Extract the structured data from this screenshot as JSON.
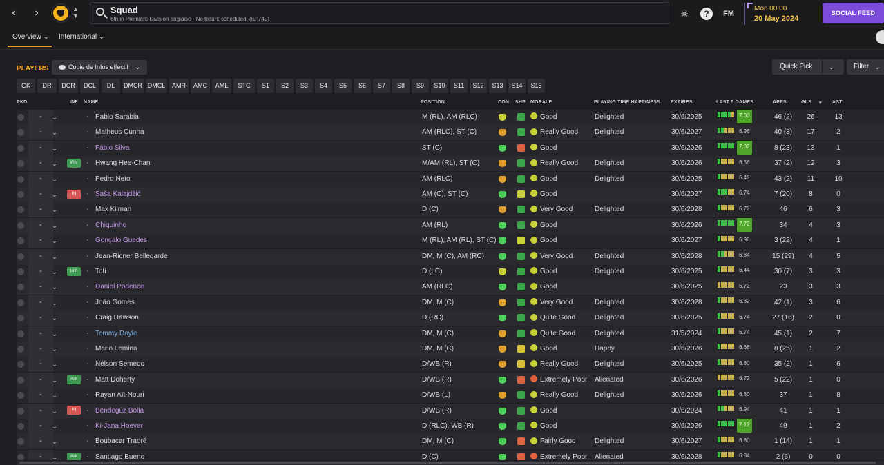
{
  "header": {
    "title": "Squad",
    "subtitle": "6th in Première Division anglaise - No fixture scheduled. (ID:740)",
    "date_line1": "Mon 00:00",
    "date_line2": "20 May 2024",
    "social_feed": "SOCIAL FEED",
    "fm_label": "FM",
    "help_label": "?"
  },
  "tabs": [
    {
      "label": "Overview ⌄"
    },
    {
      "label": "International ⌄"
    }
  ],
  "toolbar": {
    "players_label": "PLAYERS",
    "view_selector": "Copie de Infos effectif",
    "quick_pick": "Quick Pick",
    "filter": "Filter"
  },
  "position_filters": [
    "GK",
    "DR",
    "DCR",
    "DCL",
    "DL",
    "DMCR",
    "DMCL",
    "AMR",
    "AMC",
    "AML",
    "STC",
    "S1",
    "S2",
    "S3",
    "S4",
    "S5",
    "S6",
    "S7",
    "S8",
    "S9",
    "S10",
    "S11",
    "S12",
    "S13",
    "S14",
    "S15"
  ],
  "columns": {
    "pkd": "PKD",
    "inf": "INF",
    "name": "NAME",
    "position": "POSITION",
    "con": "CON",
    "shp": "SHP",
    "morale": "MORALE",
    "pth": "PLAYING TIME HAPPINESS",
    "expires": "EXPIRES",
    "last5": "LAST 5 GAMES",
    "apps": "APPS",
    "gls": "GLS",
    "ast": "AST"
  },
  "colors": {
    "accent_orange": "#f0a12c",
    "social_purple": "#7a4cd8",
    "loan_name": "#c497ea",
    "future_name": "#7fb2e6",
    "rating_high": "#4fa52a"
  },
  "players": [
    {
      "dash": "-",
      "inf": "",
      "name": "Pablo Sarabia",
      "style": "",
      "position": "M (RL), AM (RLC)",
      "con": "#c9d13a",
      "shp": "#3aa84a",
      "morale": "Good",
      "mcol": "#c9d13a",
      "pth": "Delighted",
      "expires": "30/6/2025",
      "bars": [
        "#3fbf4a",
        "#3fbf4a",
        "#3fbf4a",
        "#3fbf4a",
        "#c8b050"
      ],
      "rating": "7.00",
      "hi": true,
      "apps": "46 (2)",
      "gls": "26",
      "ast": "13"
    },
    {
      "dash": "-",
      "inf": "",
      "name": "Matheus Cunha",
      "style": "",
      "position": "AM (RLC), ST (C)",
      "con": "#e0a030",
      "shp": "#3aa84a",
      "morale": "Really Good",
      "mcol": "#c9d13a",
      "pth": "Delighted",
      "expires": "30/6/2027",
      "bars": [
        "#3fbf4a",
        "#3fbf4a",
        "#c8b050",
        "#c8b050",
        "#c8b050"
      ],
      "rating": "6.96",
      "hi": false,
      "apps": "40 (3)",
      "gls": "17",
      "ast": "2"
    },
    {
      "dash": "-",
      "inf": "",
      "name": "Fábio Silva",
      "style": "loan",
      "position": "ST (C)",
      "con": "#4fd05a",
      "shp": "#e06040",
      "morale": "Good",
      "mcol": "#c9d13a",
      "pth": "",
      "expires": "30/6/2026",
      "bars": [
        "#3fbf4a",
        "#3fbf4a",
        "#3fbf4a",
        "#3fbf4a",
        "#3fbf4a"
      ],
      "rating": "7.02",
      "hi": true,
      "apps": "8 (23)",
      "gls": "13",
      "ast": "1"
    },
    {
      "dash": "-",
      "inf": "Wnt",
      "infc": "green",
      "name": "Hwang Hee-Chan",
      "style": "",
      "position": "M/AM (RL), ST (C)",
      "con": "#e0a030",
      "shp": "#3aa84a",
      "morale": "Really Good",
      "mcol": "#c9d13a",
      "pth": "Delighted",
      "expires": "30/6/2026",
      "bars": [
        "#3fbf4a",
        "#c8b050",
        "#c8b050",
        "#c8b050",
        "#c8b050"
      ],
      "rating": "6.56",
      "hi": false,
      "apps": "37 (2)",
      "gls": "12",
      "ast": "3"
    },
    {
      "dash": "-",
      "inf": "",
      "name": "Pedro Neto",
      "style": "",
      "position": "AM (RLC)",
      "con": "#e0a030",
      "shp": "#3aa84a",
      "morale": "Good",
      "mcol": "#c9d13a",
      "pth": "Delighted",
      "expires": "30/6/2025",
      "bars": [
        "#3fbf4a",
        "#c8b050",
        "#c8b050",
        "#c8b050",
        "#c8b050"
      ],
      "rating": "6.42",
      "hi": false,
      "apps": "43 (2)",
      "gls": "11",
      "ast": "10"
    },
    {
      "dash": "-",
      "inf": "Inj",
      "infc": "red",
      "name": "Saša Kalajdžić",
      "style": "loan",
      "position": "AM (C), ST (C)",
      "con": "#4fd05a",
      "shp": "#c9d13a",
      "morale": "Good",
      "mcol": "#c9d13a",
      "pth": "",
      "expires": "30/6/2027",
      "bars": [
        "#3fbf4a",
        "#3fbf4a",
        "#3fbf4a",
        "#c8b050",
        "#c8b050"
      ],
      "rating": "6.74",
      "hi": false,
      "apps": "7 (20)",
      "gls": "8",
      "ast": "0"
    },
    {
      "dash": "-",
      "inf": "",
      "name": "Max Kilman",
      "style": "",
      "position": "D (C)",
      "con": "#e0a030",
      "shp": "#3aa84a",
      "morale": "Very Good",
      "mcol": "#c9d13a",
      "pth": "Delighted",
      "expires": "30/6/2028",
      "bars": [
        "#3fbf4a",
        "#c8b050",
        "#c8b050",
        "#c8b050",
        "#c8b050"
      ],
      "rating": "6.72",
      "hi": false,
      "apps": "46",
      "gls": "6",
      "ast": "3"
    },
    {
      "dash": "-",
      "inf": "",
      "name": "Chiquinho",
      "style": "loan",
      "position": "AM (RL)",
      "con": "#4fd05a",
      "shp": "#3aa84a",
      "morale": "Good",
      "mcol": "#c9d13a",
      "pth": "",
      "expires": "30/6/2026",
      "bars": [
        "#3fbf4a",
        "#3fbf4a",
        "#3fbf4a",
        "#3fbf4a",
        "#3fbf4a"
      ],
      "rating": "7.72",
      "hi": true,
      "apps": "34",
      "gls": "4",
      "ast": "3"
    },
    {
      "dash": "-",
      "inf": "",
      "name": "Gonçalo Guedes",
      "style": "loan",
      "position": "M (RL), AM (RL), ST (C)",
      "con": "#4fd05a",
      "shp": "#c9d13a",
      "morale": "Good",
      "mcol": "#c9d13a",
      "pth": "",
      "expires": "30/6/2027",
      "bars": [
        "#3fbf4a",
        "#c8b050",
        "#c8b050",
        "#c8b050",
        "#c8b050"
      ],
      "rating": "6.98",
      "hi": false,
      "apps": "3 (22)",
      "gls": "4",
      "ast": "1"
    },
    {
      "dash": "-",
      "inf": "",
      "name": "Jean-Ricner Bellegarde",
      "style": "",
      "position": "DM, M (C), AM (RC)",
      "con": "#4fd05a",
      "shp": "#3aa84a",
      "morale": "Very Good",
      "mcol": "#c9d13a",
      "pth": "Delighted",
      "expires": "30/6/2028",
      "bars": [
        "#3fbf4a",
        "#3fbf4a",
        "#c8b050",
        "#c8b050",
        "#c8b050"
      ],
      "rating": "6.84",
      "hi": false,
      "apps": "15 (29)",
      "gls": "4",
      "ast": "5"
    },
    {
      "dash": "-",
      "inf": "Unh",
      "infc": "green",
      "name": "Toti",
      "style": "",
      "position": "D (LC)",
      "con": "#c9d13a",
      "shp": "#3aa84a",
      "morale": "Good",
      "mcol": "#c9d13a",
      "pth": "Delighted",
      "expires": "30/6/2025",
      "bars": [
        "#3fbf4a",
        "#c8b050",
        "#c8b050",
        "#c8b050",
        "#c8b050"
      ],
      "rating": "6.44",
      "hi": false,
      "apps": "30 (7)",
      "gls": "3",
      "ast": "3"
    },
    {
      "dash": "-",
      "inf": "",
      "name": "Daniel Podence",
      "style": "loan",
      "position": "AM (RLC)",
      "con": "#4fd05a",
      "shp": "#3aa84a",
      "morale": "Good",
      "mcol": "#c9d13a",
      "pth": "",
      "expires": "30/6/2025",
      "bars": [
        "#c8b050",
        "#c8b050",
        "#c8b050",
        "#c8b050",
        "#c8b050"
      ],
      "rating": "6.72",
      "hi": false,
      "apps": "23",
      "gls": "3",
      "ast": "3"
    },
    {
      "dash": "-",
      "inf": "",
      "name": "João Gomes",
      "style": "",
      "position": "DM, M (C)",
      "con": "#e0a030",
      "shp": "#3aa84a",
      "morale": "Very Good",
      "mcol": "#c9d13a",
      "pth": "Delighted",
      "expires": "30/6/2028",
      "bars": [
        "#3fbf4a",
        "#c8b050",
        "#c8b050",
        "#c8b050",
        "#c8b050"
      ],
      "rating": "6.82",
      "hi": false,
      "apps": "42 (1)",
      "gls": "3",
      "ast": "6"
    },
    {
      "dash": "-",
      "inf": "",
      "name": "Craig Dawson",
      "style": "",
      "position": "D (RC)",
      "con": "#4fd05a",
      "shp": "#3aa84a",
      "morale": "Quite Good",
      "mcol": "#c9d13a",
      "pth": "Delighted",
      "expires": "30/6/2025",
      "bars": [
        "#3fbf4a",
        "#c8b050",
        "#c8b050",
        "#c8b050",
        "#c8b050"
      ],
      "rating": "6.74",
      "hi": false,
      "apps": "27 (16)",
      "gls": "2",
      "ast": "0"
    },
    {
      "dash": "-",
      "inf": "",
      "name": "Tommy Doyle",
      "style": "future",
      "position": "DM, M (C)",
      "con": "#e0a030",
      "shp": "#3aa84a",
      "morale": "Quite Good",
      "mcol": "#c9d13a",
      "pth": "Delighted",
      "expires": "31/5/2024",
      "bars": [
        "#3fbf4a",
        "#c8b050",
        "#c8b050",
        "#c8b050",
        "#c8b050"
      ],
      "rating": "6.74",
      "hi": false,
      "apps": "45 (1)",
      "gls": "2",
      "ast": "7"
    },
    {
      "dash": "-",
      "inf": "",
      "name": "Mario Lemina",
      "style": "",
      "position": "DM, M (C)",
      "con": "#e0a030",
      "shp": "#d9c23a",
      "morale": "Good",
      "mcol": "#c9d13a",
      "pth": "Happy",
      "expires": "30/6/2026",
      "bars": [
        "#3fbf4a",
        "#c8b050",
        "#c8b050",
        "#c8b050",
        "#c8b050"
      ],
      "rating": "6.66",
      "hi": false,
      "apps": "8 (25)",
      "gls": "1",
      "ast": "2"
    },
    {
      "dash": "-",
      "inf": "",
      "name": "Nélson Semedo",
      "style": "",
      "position": "D/WB (R)",
      "con": "#e0a030",
      "shp": "#d9c23a",
      "morale": "Really Good",
      "mcol": "#c9d13a",
      "pth": "Delighted",
      "expires": "30/6/2025",
      "bars": [
        "#3fbf4a",
        "#c8b050",
        "#c8b050",
        "#c8b050",
        "#c8b050"
      ],
      "rating": "6.80",
      "hi": false,
      "apps": "35 (2)",
      "gls": "1",
      "ast": "6"
    },
    {
      "dash": "-",
      "inf": "Ask",
      "infc": "green",
      "name": "Matt Doherty",
      "style": "",
      "position": "D/WB (R)",
      "con": "#4fd05a",
      "shp": "#e06040",
      "morale": "Extremely Poor",
      "mcol": "#e06040",
      "pth": "Alienated",
      "expires": "30/6/2026",
      "bars": [
        "#c8b050",
        "#c8b050",
        "#c8b050",
        "#c8b050",
        "#c8b050"
      ],
      "rating": "6.72",
      "hi": false,
      "apps": "5 (22)",
      "gls": "1",
      "ast": "0"
    },
    {
      "dash": "-",
      "inf": "",
      "name": "Rayan Aït-Nouri",
      "style": "",
      "position": "D/WB (L)",
      "con": "#e0a030",
      "shp": "#3aa84a",
      "morale": "Really Good",
      "mcol": "#c9d13a",
      "pth": "Delighted",
      "expires": "30/6/2026",
      "bars": [
        "#3fbf4a",
        "#c8b050",
        "#c8b050",
        "#c8b050",
        "#c8b050"
      ],
      "rating": "6.80",
      "hi": false,
      "apps": "37",
      "gls": "1",
      "ast": "8"
    },
    {
      "dash": "-",
      "inf": "Inj",
      "infc": "red",
      "name": "Bendegúz Bolla",
      "style": "loan",
      "position": "D/WB (R)",
      "con": "#4fd05a",
      "shp": "#3aa84a",
      "morale": "Good",
      "mcol": "#c9d13a",
      "pth": "",
      "expires": "30/6/2024",
      "bars": [
        "#3fbf4a",
        "#3fbf4a",
        "#c8b050",
        "#c8b050",
        "#c8b050"
      ],
      "rating": "6.94",
      "hi": false,
      "apps": "41",
      "gls": "1",
      "ast": "1"
    },
    {
      "dash": "-",
      "inf": "",
      "name": "Ki-Jana Hoever",
      "style": "loan",
      "position": "D (RLC), WB (R)",
      "con": "#4fd05a",
      "shp": "#3aa84a",
      "morale": "Good",
      "mcol": "#c9d13a",
      "pth": "",
      "expires": "30/6/2026",
      "bars": [
        "#3fbf4a",
        "#3fbf4a",
        "#3fbf4a",
        "#3fbf4a",
        "#3fbf4a"
      ],
      "rating": "7.12",
      "hi": true,
      "apps": "49",
      "gls": "1",
      "ast": "2"
    },
    {
      "dash": "-",
      "inf": "",
      "name": "Boubacar Traoré",
      "style": "",
      "position": "DM, M (C)",
      "con": "#4fd05a",
      "shp": "#e06040",
      "morale": "Fairly Good",
      "mcol": "#c9d13a",
      "pth": "Delighted",
      "expires": "30/6/2027",
      "bars": [
        "#3fbf4a",
        "#c8b050",
        "#c8b050",
        "#c8b050",
        "#c8b050"
      ],
      "rating": "6.80",
      "hi": false,
      "apps": "1 (14)",
      "gls": "1",
      "ast": "1"
    },
    {
      "dash": "-",
      "inf": "Ask",
      "infc": "green",
      "name": "Santiago Bueno",
      "style": "",
      "position": "D (C)",
      "con": "#4fd05a",
      "shp": "#e06040",
      "morale": "Extremely Poor",
      "mcol": "#e06040",
      "pth": "Alienated",
      "expires": "30/6/2028",
      "bars": [
        "#3fbf4a",
        "#c8b050",
        "#c8b050",
        "#c8b050",
        "#c8b050"
      ],
      "rating": "6.84",
      "hi": false,
      "apps": "2 (6)",
      "gls": "0",
      "ast": "0"
    }
  ]
}
